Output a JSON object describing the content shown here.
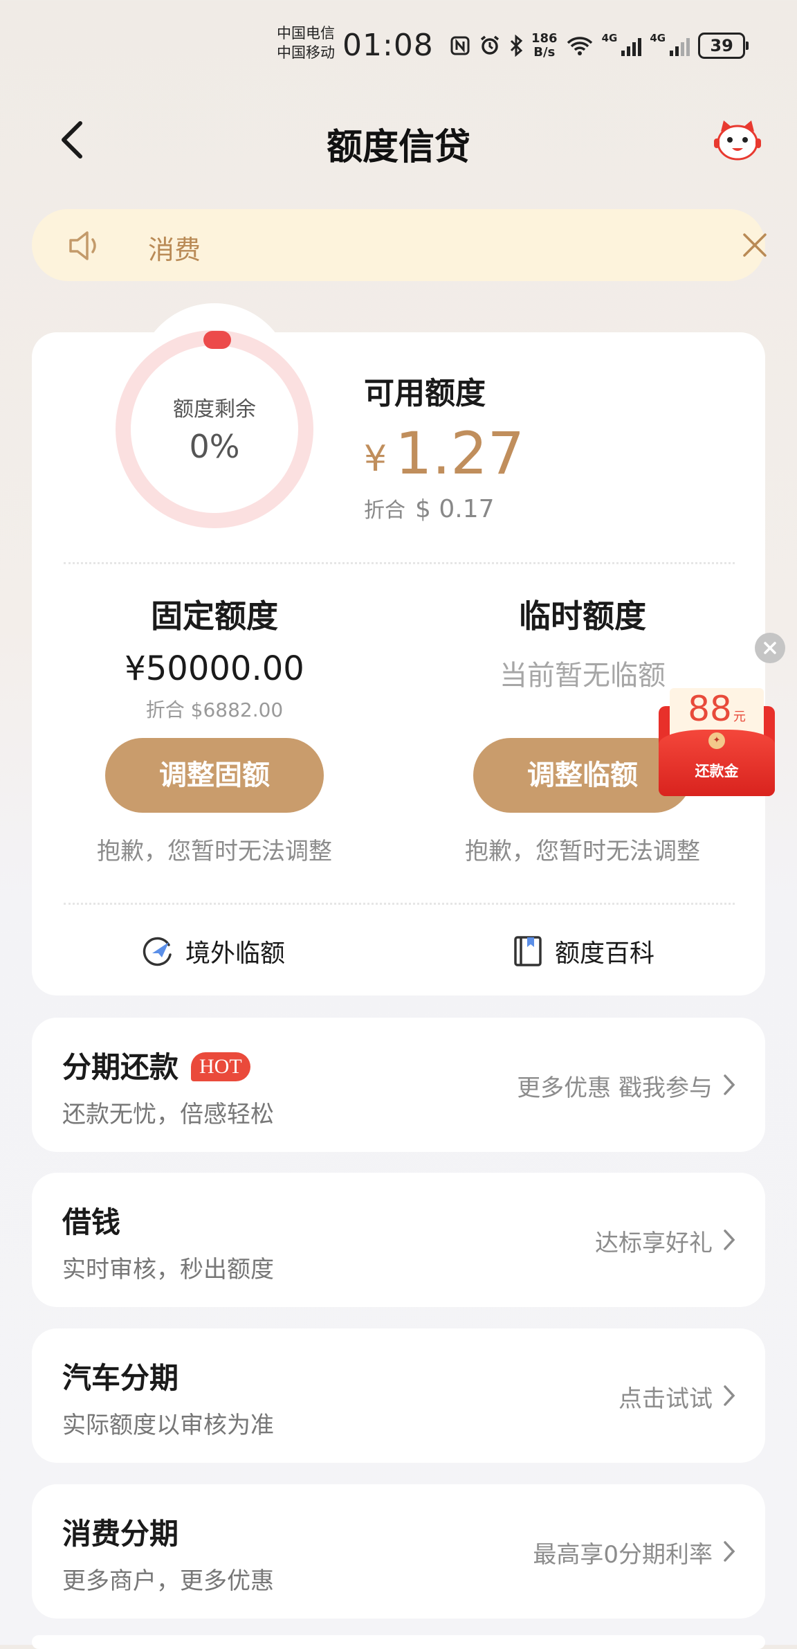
{
  "status_bar": {
    "carrier1": "中国电信",
    "carrier2": "中国移动",
    "time": "01:08",
    "speed_top": "186",
    "speed_bottom": "B/s",
    "net1": "4G",
    "net2": "4G",
    "battery": "39"
  },
  "nav": {
    "title": "额度信贷"
  },
  "notice": {
    "text": "消费"
  },
  "credit": {
    "ring_label": "额度剩余",
    "ring_percent": "0%",
    "ring_fraction": 0,
    "available_title": "可用额度",
    "available_currency": "¥",
    "available_amount": "1.27",
    "converted_label": "折合",
    "converted_amount": "$ 0.17"
  },
  "fixed": {
    "title": "固定额度",
    "amount": "¥50000.00",
    "converted": "折合 $6882.00",
    "button": "调整固额",
    "note": "抱歉，您暂时无法调整"
  },
  "temporary": {
    "title": "临时额度",
    "status": "当前暂无临额",
    "button": "调整临额",
    "note": "抱歉，您暂时无法调整"
  },
  "links": {
    "overseas": "境外临额",
    "encyclopedia": "额度百科"
  },
  "promo": {
    "amount": "88",
    "unit": "元",
    "label": "还款金"
  },
  "list": [
    {
      "title": "分期还款",
      "badge": "HOT",
      "desc": "还款无忧，倍感轻松",
      "action": "更多优惠 戳我参与"
    },
    {
      "title": "借钱",
      "desc": "实时审核，秒出额度",
      "action": "达标享好礼"
    },
    {
      "title": "汽车分期",
      "desc": "实际额度以审核为准",
      "action": "点击试试"
    },
    {
      "title": "消费分期",
      "desc": "更多商户，更多优惠",
      "action": "最高享0分期利率"
    }
  ],
  "colors": {
    "accent": "#c99c6c",
    "amount": "#c08e5c",
    "notice_bg": "#fdf3dc",
    "ring_track": "#fbe0e0",
    "ring_dot": "#ec4a4a",
    "hot": "#ea4a3b"
  }
}
